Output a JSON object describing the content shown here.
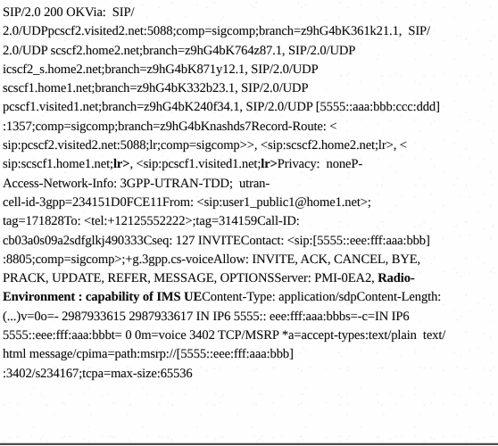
{
  "document": {
    "kind": "scanned-page",
    "content_type": "sip-message-trace",
    "background_color": "#fefefe",
    "text_color": "#0d0d0d",
    "rule_color": "#2e2e2e"
  },
  "message": {
    "lines": [
      {
        "id": "line-01",
        "text": "SIP/2.0 200 OKVia:  SIP/"
      },
      {
        "id": "line-02",
        "text": "2.0/UDPpcscf2.visited2.net:5088;comp=sigcomp;branch=z9hG4bK361k21.1,  SIP/"
      },
      {
        "id": "line-03",
        "text": "2.0/UDP scscf2.home2.net;branch=z9hG4bK764z87.1, SIP/2.0/UDP"
      },
      {
        "id": "line-04",
        "text": "icscf2_s.home2.net;branch=z9hG4bK871y12.1, SIP/2.0/UDP"
      },
      {
        "id": "line-05",
        "text": "scscf1.home1.net;branch=z9hG4bK332b23.1, SIP/2.0/UDP"
      },
      {
        "id": "line-06",
        "text": "pcscf1.visited1.net;branch=z9hG4bK240f34.1, SIP/2.0/UDP [5555::aaa:bbb:ccc:ddd]"
      },
      {
        "id": "line-07",
        "text": ":1357;comp=sigcomp;branch=z9hG4bKnashds7Record-Route: <"
      },
      {
        "id": "line-08",
        "text": "sip:pcscf2.visited2.net:5088;lr;comp=sigcomp>>, <sip:scscf2.home2.net;lr>, <"
      },
      {
        "id": "line-09",
        "segments": [
          {
            "text": "sip:scscf1.home1.net;"
          },
          {
            "text": "lr>",
            "bold": true
          },
          {
            "text": ", <sip:pcscf1.visited1.net;"
          },
          {
            "text": "lr>",
            "bold": true
          },
          {
            "text": "Privacy:  noneP-"
          }
        ]
      },
      {
        "id": "line-10",
        "text": "Access-Network-Info: 3GPP-UTRAN-TDD;  utran-"
      },
      {
        "id": "line-11",
        "text": "cell-id-3gpp=234151D0FCE11From: <sip:user1_public1@home1.net>;"
      },
      {
        "id": "line-12",
        "text": "tag=171828To: <tel:+12125552222>;tag=314159Call-ID:"
      },
      {
        "id": "line-13",
        "text": "cb03a0s09a2sdfglkj490333Cseq: 127 INVITEContact: <sip:[5555::eee:fff:aaa:bbb]"
      },
      {
        "id": "line-14",
        "text": ":8805;comp=sigcomp>;+g.3gpp.cs-voiceAllow: INVITE, ACK, CANCEL, BYE,"
      },
      {
        "id": "line-15",
        "segments": [
          {
            "text": "PRACK, UPDATE, REFER, MESSAGE, OPTIONSServer: PMI-0EA2, "
          },
          {
            "text": "Radio-",
            "bold": true
          }
        ]
      },
      {
        "id": "line-16",
        "segments": [
          {
            "text": "Environment : capability of IMS UE",
            "bold": true
          },
          {
            "text": "Content-Type: application/sdpContent-Length:"
          }
        ]
      },
      {
        "id": "line-17",
        "text": "(...)v=0o=- 2987933615 2987933617 IN IP6 5555:: eee:fff:aaa:bbbs=-c=IN IP6"
      },
      {
        "id": "line-18",
        "text": "5555::eee:fff:aaa:bbbt= 0 0m=voice 3402 TCP/MSRP *a=accept-types:text/plain  text/"
      },
      {
        "id": "line-19",
        "text": "html message/cpima=path:msrp://[5555::eee:fff:aaa:bbb]"
      },
      {
        "id": "line-20",
        "text": ":3402/s234167;tcpa=max-size:65536"
      }
    ]
  }
}
